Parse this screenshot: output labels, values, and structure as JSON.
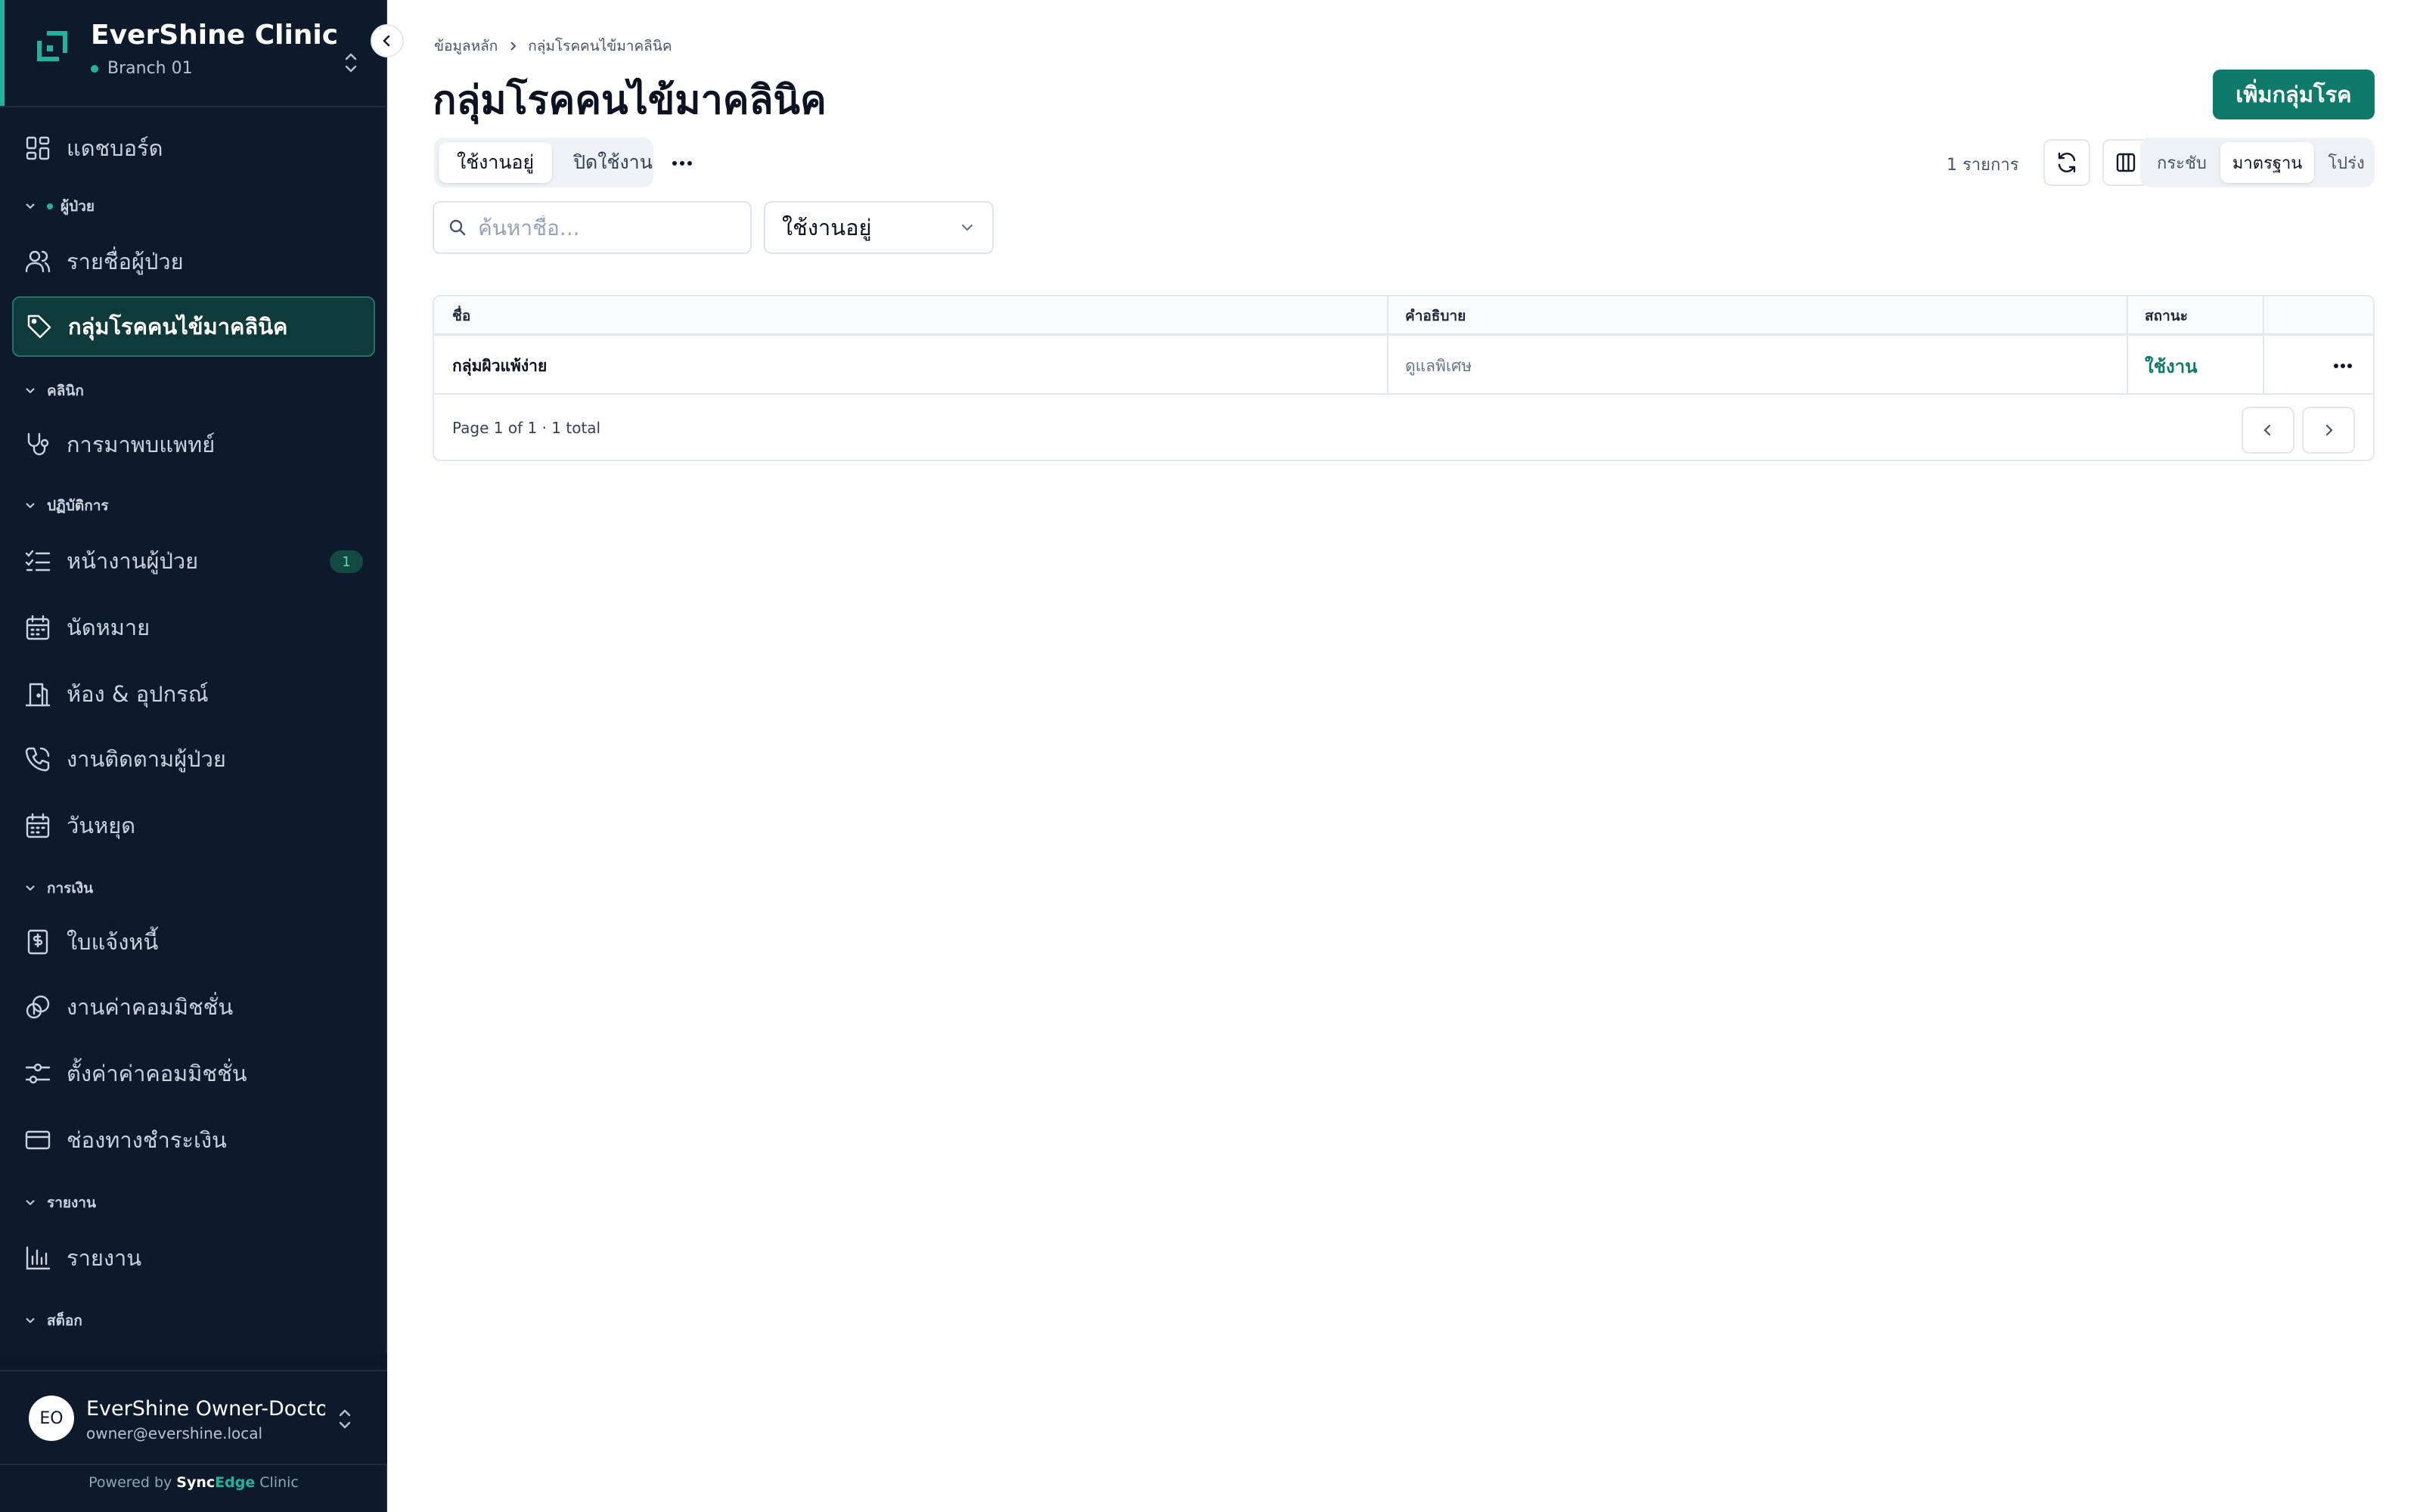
{
  "sidebar": {
    "clinic_name": "EverShine Clinic",
    "branch": "Branch 01",
    "items": [
      {
        "label": "แดชบอร์ด",
        "icon": "dashboard-icon"
      },
      {
        "label": "รายชื่อผู้ป่วย",
        "icon": "users-icon"
      },
      {
        "label": "กลุ่มโรคคนไข้มาคลินิค",
        "icon": "tag-icon",
        "active": true
      },
      {
        "label": "การมาพบแพทย์",
        "icon": "stethoscope-icon"
      },
      {
        "label": "หน้างานผู้ป่วย",
        "icon": "checklist-icon",
        "badge": "1"
      },
      {
        "label": "นัดหมาย",
        "icon": "calendar-icon"
      },
      {
        "label": "ห้อง & อุปกรณ์",
        "icon": "door-icon"
      },
      {
        "label": "งานติดตามผู้ป่วย",
        "icon": "phone-icon"
      },
      {
        "label": "วันหยุด",
        "icon": "calendar-icon"
      },
      {
        "label": "ใบแจ้งหนี้",
        "icon": "invoice-icon"
      },
      {
        "label": "งานค่าคอมมิชชั่น",
        "icon": "coins-icon"
      },
      {
        "label": "ตั้งค่าค่าคอมมิชชั่น",
        "icon": "sliders-icon"
      },
      {
        "label": "ช่องทางชำระเงิน",
        "icon": "credit-card-icon"
      },
      {
        "label": "รายงาน",
        "icon": "bar-chart-icon"
      }
    ],
    "sections": {
      "patients": "ผู้ป่วย",
      "clinic": "คลินิก",
      "operations": "ปฏิบัติการ",
      "finance": "การเงิน",
      "reports": "รายงาน",
      "stock": "สต็อก"
    },
    "user": {
      "initials": "EO",
      "name": "EverShine Owner-Doctor",
      "email": "owner@evershine.local"
    },
    "powered_prefix": "Powered by",
    "powered_sync": "Sync",
    "powered_edge": "Edge",
    "powered_suffix": "Clinic"
  },
  "header": {
    "breadcrumb": [
      "ข้อมูลหลัก",
      "กลุ่มโรคคนไข้มาคลินิค"
    ],
    "title": "กลุ่มโรคคนไข้มาคลินิค",
    "add_button": "เพิ่มกลุ่มโรค"
  },
  "toolbar": {
    "status_tabs": [
      "ใช้งานอยู่",
      "ปิดใช้งาน"
    ],
    "count_label": "1 รายการ",
    "density": [
      "กระชับ",
      "มาตรฐาน",
      "โปร่ง"
    ],
    "search_placeholder": "ค้นหาชื่อ...",
    "status_filter": "ใช้งานอยู่"
  },
  "table": {
    "columns": [
      "ชื่อ",
      "คำอธิบาย",
      "สถานะ"
    ],
    "rows": [
      {
        "name": "กลุ่มผิวแพ้ง่าย",
        "description": "ดูแลพิเศษ",
        "status": "ใช้งาน"
      }
    ],
    "page_info": "Page 1 of 1 · 1 total"
  },
  "colors": {
    "sidebar_bg": "#0d1a2b",
    "accent": "#0f7a6a",
    "accent_light": "#22b3a0"
  }
}
